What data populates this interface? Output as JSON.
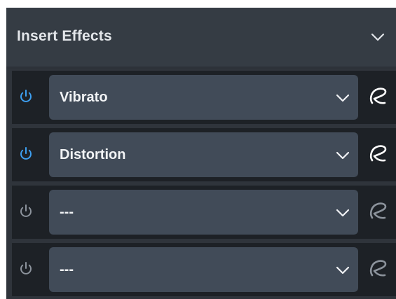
{
  "panel": {
    "title": "Insert Effects",
    "toggle_icon": "chevron-down-icon"
  },
  "slots": [
    {
      "effect": "Vibrato",
      "enabled": true,
      "power_icon": "power-icon",
      "dropdown_icon": "chevron-down-icon",
      "edit_icon": "edit-icon"
    },
    {
      "effect": "Distortion",
      "enabled": true,
      "power_icon": "power-icon",
      "dropdown_icon": "chevron-down-icon",
      "edit_icon": "edit-icon"
    },
    {
      "effect": "---",
      "enabled": false,
      "power_icon": "power-icon",
      "dropdown_icon": "chevron-down-icon",
      "edit_icon": "edit-icon"
    },
    {
      "effect": "---",
      "enabled": false,
      "power_icon": "power-icon",
      "dropdown_icon": "chevron-down-icon",
      "edit_icon": "edit-icon"
    }
  ],
  "colors": {
    "power_on": "#3d9ff0",
    "power_off": "#8c939c",
    "edit_on": "#ffffff",
    "edit_off": "#8c939c"
  }
}
